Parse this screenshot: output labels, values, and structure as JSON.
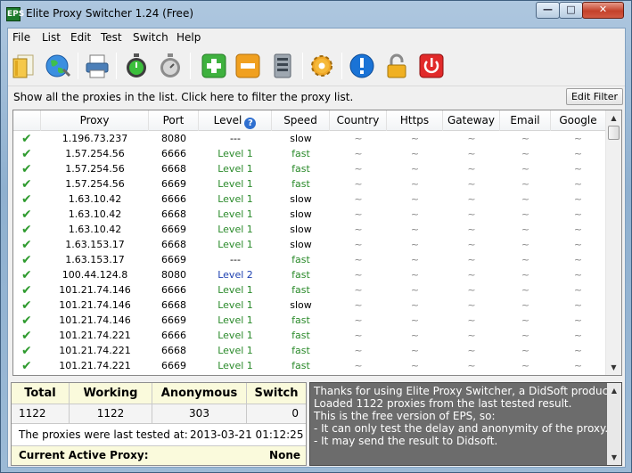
{
  "window": {
    "title": "Elite Proxy Switcher 1.24 (Free)",
    "min": "—",
    "max": "□",
    "close": "✕",
    "app_icon": "EPS"
  },
  "menu": [
    "File",
    "List",
    "Edit",
    "Test",
    "Switch",
    "Help"
  ],
  "toolbar": {
    "icons": [
      "open-file-icon",
      "globe-icon",
      "printer-icon",
      "stopwatch-green-icon",
      "stopwatch-gray-icon",
      "add-icon",
      "remove-icon",
      "server-icon",
      "settings-gear-icon",
      "info-icon",
      "lock-icon",
      "power-icon"
    ]
  },
  "filter": {
    "text": "Show all the proxies in the list. Click here to filter the proxy list.",
    "button": "Edit Filter"
  },
  "table": {
    "columns": [
      "Proxy",
      "Port",
      "Level",
      "Speed",
      "Country",
      "Https",
      "Gateway",
      "Email",
      "Google"
    ],
    "help_glyph": "?",
    "rows": [
      {
        "proxy": "1.196.73.237",
        "port": "8080",
        "level": "---",
        "speed": "slow"
      },
      {
        "proxy": "1.57.254.56",
        "port": "6666",
        "level": "Level 1",
        "speed": "fast"
      },
      {
        "proxy": "1.57.254.56",
        "port": "6668",
        "level": "Level 1",
        "speed": "fast"
      },
      {
        "proxy": "1.57.254.56",
        "port": "6669",
        "level": "Level 1",
        "speed": "fast"
      },
      {
        "proxy": "1.63.10.42",
        "port": "6666",
        "level": "Level 1",
        "speed": "slow"
      },
      {
        "proxy": "1.63.10.42",
        "port": "6668",
        "level": "Level 1",
        "speed": "slow"
      },
      {
        "proxy": "1.63.10.42",
        "port": "6669",
        "level": "Level 1",
        "speed": "slow"
      },
      {
        "proxy": "1.63.153.17",
        "port": "6668",
        "level": "Level 1",
        "speed": "slow"
      },
      {
        "proxy": "1.63.153.17",
        "port": "6669",
        "level": "---",
        "speed": "fast"
      },
      {
        "proxy": "100.44.124.8",
        "port": "8080",
        "level": "Level 2",
        "speed": "fast"
      },
      {
        "proxy": "101.21.74.146",
        "port": "6666",
        "level": "Level 1",
        "speed": "fast"
      },
      {
        "proxy": "101.21.74.146",
        "port": "6668",
        "level": "Level 1",
        "speed": "slow"
      },
      {
        "proxy": "101.21.74.146",
        "port": "6669",
        "level": "Level 1",
        "speed": "fast"
      },
      {
        "proxy": "101.21.74.221",
        "port": "6666",
        "level": "Level 1",
        "speed": "fast"
      },
      {
        "proxy": "101.21.74.221",
        "port": "6668",
        "level": "Level 1",
        "speed": "fast"
      },
      {
        "proxy": "101.21.74.221",
        "port": "6669",
        "level": "Level 1",
        "speed": "fast"
      }
    ],
    "empty_mark": "~",
    "check_glyph": "✔"
  },
  "stats": {
    "headers": [
      "Total",
      "Working",
      "Anonymous",
      "Switch"
    ],
    "values": [
      "1122",
      "1122",
      "303",
      "0"
    ],
    "last_tested_label": "The proxies were last tested at:",
    "last_tested_value": "2013-03-21 01:12:25",
    "active_label": "Current Active Proxy:",
    "active_value": "None"
  },
  "log": [
    "Thanks for using Elite Proxy Switcher, a DidSoft product.",
    "Loaded 1122 proxies from the last tested result.",
    "This is the free version of EPS, so:",
    "- It can only test the delay and anonymity of the proxy.",
    "- It may send the result to Didsoft."
  ],
  "colors": {
    "green_text": "#2a8a2a",
    "blue_text": "#1d40b0",
    "log_bg": "#6c6c6c",
    "stats_header_bg": "#fafadc"
  }
}
